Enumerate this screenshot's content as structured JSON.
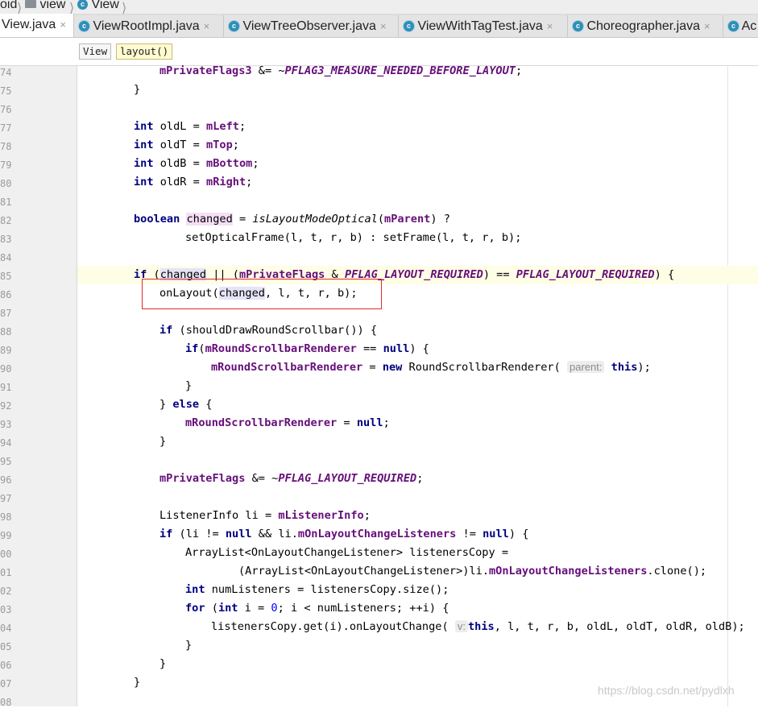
{
  "breadcrumb": {
    "items": [
      "oid",
      "view",
      "View"
    ]
  },
  "tabs": [
    {
      "label": "View.java",
      "active": true
    },
    {
      "label": "ViewRootImpl.java",
      "active": false
    },
    {
      "label": "ViewTreeObserver.java",
      "active": false
    },
    {
      "label": "ViewWithTagTest.java",
      "active": false
    },
    {
      "label": "Choreographer.java",
      "active": false
    },
    {
      "label": "Ac",
      "active": false
    }
  ],
  "structure_path": {
    "class_label": "View",
    "method_label": "layout()"
  },
  "line_numbers": [
    "74",
    "75",
    "77",
    "78",
    "79",
    "80",
    "81",
    "82",
    "83",
    "84",
    "85",
    "86",
    "87",
    "88",
    "89",
    "90",
    "91",
    "92",
    "93",
    "94",
    "95",
    "96",
    "97",
    "98",
    "99",
    "00",
    "01",
    "02",
    "03",
    "04",
    "05",
    "06",
    "07",
    "08"
  ],
  "code": {
    "l74": {
      "field": "mPrivateFlags3",
      "op": " &= ~",
      "const": "PFLAG3_MEASURE_NEEDED_BEFORE_LAYOUT",
      "end": ";"
    },
    "l75": "}",
    "l77": {
      "kw": "int",
      "var": " oldL = ",
      "field": "mLeft",
      "end": ";"
    },
    "l78": {
      "kw": "int",
      "var": " oldT = ",
      "field": "mTop",
      "end": ";"
    },
    "l79": {
      "kw": "int",
      "var": " oldB = ",
      "field": "mBottom",
      "end": ";"
    },
    "l80": {
      "kw": "int",
      "var": " oldR = ",
      "field": "mRight",
      "end": ";"
    },
    "l82": {
      "kw": "boolean",
      "var": "changed",
      "eq": " = ",
      "call": "isLayoutModeOptical",
      "open": "(",
      "field": "mParent",
      "rest": ") ?"
    },
    "l83": "setOpticalFrame(l, t, r, b) : setFrame(l, t, r, b);",
    "l85": {
      "kw": "if",
      "p1": " (",
      "var": "changed",
      "p2": " || (",
      "field": "mPrivateFlags",
      "p3": " & ",
      "c1": "PFLAG_LAYOUT_REQUIRED",
      "p4": ") == ",
      "c2": "PFLAG_LAYOUT_REQUIRED",
      "p5": ") {"
    },
    "l86": {
      "pre": "onLayout(",
      "var": "changed",
      "post": ", l, t, r, b);"
    },
    "l88": {
      "kw": "if",
      "rest": " (shouldDrawRoundScrollbar()) {"
    },
    "l89": {
      "kw": "if",
      "p1": "(",
      "field": "mRoundScrollbarRenderer",
      "p2": " == ",
      "kw2": "null",
      "p3": ") {"
    },
    "l90": {
      "field": "mRoundScrollbarRenderer",
      "p1": " = ",
      "kw": "new",
      "p2": " RoundScrollbarRenderer(",
      "hint": "parent:",
      "kw2": "this",
      "p3": ");"
    },
    "l91": "}",
    "l92": {
      "p1": "} ",
      "kw": "else",
      "p2": " {"
    },
    "l93": {
      "field": "mRoundScrollbarRenderer",
      "p1": " = ",
      "kw": "null",
      "p2": ";"
    },
    "l94": "}",
    "l96": {
      "field": "mPrivateFlags",
      "op": " &= ~",
      "const": "PFLAG_LAYOUT_REQUIRED",
      "end": ";"
    },
    "l98": {
      "pre": "ListenerInfo li = ",
      "field": "mListenerInfo",
      "end": ";"
    },
    "l99": {
      "kw": "if",
      "p1": " (li != ",
      "kw2": "null",
      "p2": " && li.",
      "field": "mOnLayoutChangeListeners",
      "p3": " != ",
      "kw3": "null",
      "p4": ") {"
    },
    "l100": "ArrayList<OnLayoutChangeListener> listenersCopy =",
    "l101": {
      "pre": "(ArrayList<OnLayoutChangeListener>)li.",
      "field": "mOnLayoutChangeListeners",
      "post": ".clone();"
    },
    "l102": {
      "kw": "int",
      "rest": " numListeners = listenersCopy.size();"
    },
    "l103": {
      "kw": "for",
      "p1": " (",
      "kw2": "int",
      "p2": " i = ",
      "num": "0",
      "p3": "; i < numListeners; ++i) {"
    },
    "l104": {
      "pre": "listenersCopy.get(i).onLayoutChange(",
      "hint": "v:",
      "kw": "this",
      "post": ", l, t, r, b, oldL, oldT, oldR, oldB);"
    },
    "l105": "}",
    "l106": "}",
    "l107": "}"
  },
  "watermark": "https://blog.csdn.net/pydlxh",
  "colors": {
    "keyword": "#000080",
    "field": "#660e7a",
    "highlight": "#e12a2a",
    "caret_line": "#fefde6"
  }
}
